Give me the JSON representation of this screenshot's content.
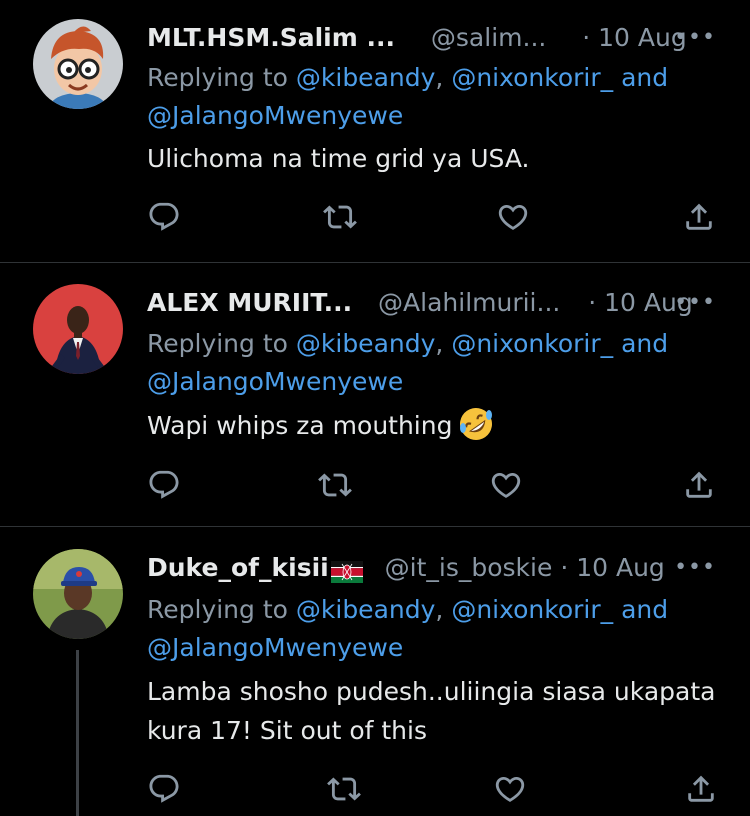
{
  "tweets": [
    {
      "name": "MLT.HSM.Salim ...",
      "handle": "@salim...",
      "date": "10 Aug",
      "replying_prefix": "Replying to ",
      "mention1": "@kibeandy",
      "sep": ", ",
      "mention2": "@nixonkorir_",
      "and": " and",
      "mention3": "@JalangoMwenyewe",
      "text": "Ulichoma na time grid ya USA."
    },
    {
      "name": "ALEX MURIIT...",
      "handle": "@Alahilmurii...",
      "date": "10 Aug",
      "replying_prefix": "Replying to ",
      "mention1": "@kibeandy",
      "sep": ", ",
      "mention2": "@nixonkorir_",
      "and": " and",
      "mention3": "@JalangoMwenyewe",
      "text": "Wapi whips za mouthing"
    },
    {
      "name": "Duke_of_kisii",
      "handle": "@it_is_boskie",
      "date": "10 Aug",
      "replying_prefix": "Replying to ",
      "mention1": "@kibeandy",
      "sep": ", ",
      "mention2": "@nixonkorir_",
      "and": " and",
      "mention3": "@JalangoMwenyewe",
      "text_line1": "Lamba shosho pudesh..uliingia siasa ukapata",
      "text_line2": "kura 17! Sit out of this"
    }
  ],
  "separators": {
    "dot": "·",
    "more": "•••"
  },
  "colors": {
    "background": "#000000",
    "text": "#e7e9ea",
    "muted": "#8b98a5",
    "link": "#4d9ee9",
    "divider": "#2f3336"
  },
  "icons": [
    "reply-icon",
    "retweet-icon",
    "like-icon",
    "share-icon",
    "more-icon",
    "kenya-flag-icon",
    "rolling-laughing-emoji-icon"
  ]
}
